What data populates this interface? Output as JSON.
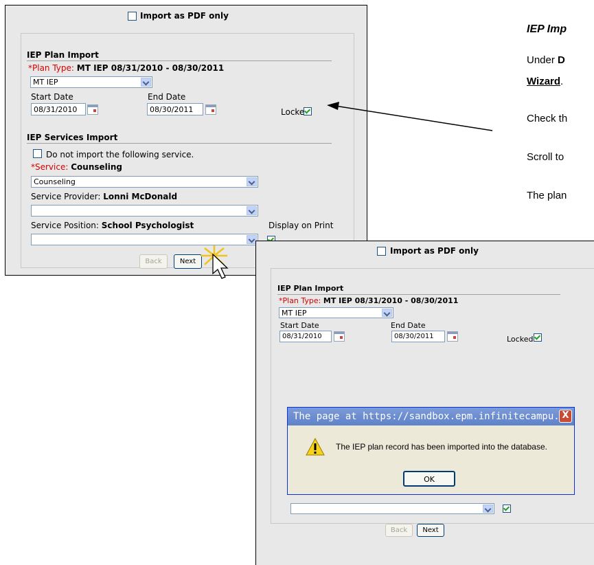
{
  "panel1": {
    "import_pdf_label": "Import as PDF only",
    "plan_import_heading": "IEP Plan Import",
    "plan_type_label": "*Plan Type:",
    "plan_type_value": "MT IEP 08/31/2010 - 08/30/2011",
    "plan_select_value": "MT IEP",
    "start_date_label": "Start Date",
    "start_date_value": "08/31/2010",
    "end_date_label": "End Date",
    "end_date_value": "08/30/2011",
    "locked_label": "Locked",
    "services_heading": "IEP Services Import",
    "no_import_label": "Do not import the following service.",
    "service_label": "*Service:",
    "service_value": "Counseling",
    "service_select_value": "Counseling",
    "provider_label": "Service Provider:",
    "provider_value": "Lonni McDonald",
    "position_label": "Service Position:",
    "position_value": "School Psychologist",
    "display_print_label": "Display on Print",
    "back_label": "Back",
    "next_label": "Next"
  },
  "panel2": {
    "import_pdf_label": "Import as PDF only",
    "plan_import_heading": "IEP Plan Import",
    "plan_type_label": "*Plan Type:",
    "plan_type_value": "MT IEP 08/31/2010 - 08/30/2011",
    "plan_select_value": "MT IEP",
    "start_date_label": "Start Date",
    "start_date_value": "08/31/2010",
    "end_date_label": "End Date",
    "end_date_value": "08/30/2011",
    "locked_label": "Locked",
    "back_label": "Back",
    "next_label": "Next"
  },
  "dialog": {
    "title": "The page at https://sandbox.epm.infinitecampu...",
    "message": "The IEP plan record has been imported into the database.",
    "ok_label": "OK",
    "close_symbol": "X"
  },
  "doc": {
    "heading": "IEP Imp",
    "line1_prefix": "Under",
    "line1_bold": "D",
    "line2": "Wizard",
    "line2_suffix": ".",
    "line3": "Check th",
    "line4": "Scroll to",
    "line5": "The plan"
  },
  "colors": {
    "panel_bg": "#e8e8e8",
    "required_red": "#d40000",
    "check_green": "#21a121",
    "dialog_bg": "#ece9d8",
    "titlebar_blue": "#6b8ed0"
  }
}
